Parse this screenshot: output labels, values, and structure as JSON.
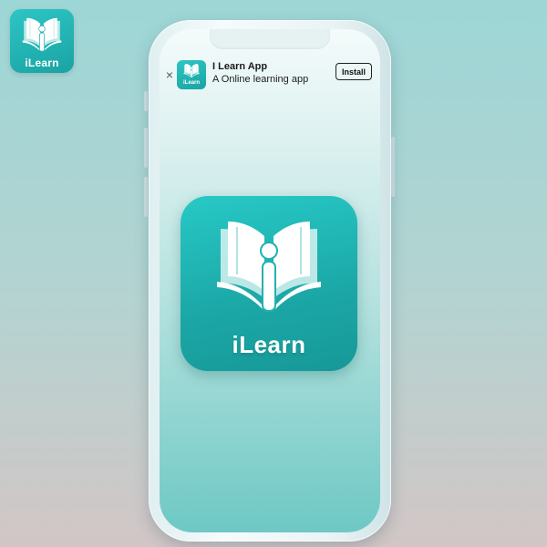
{
  "brand": {
    "name": "iLearn",
    "logo_icon": "open-book-person-icon",
    "primary_color": "#1fb3b1",
    "accent_color": "#2cc6c4"
  },
  "app_banner": {
    "close_label": "×",
    "app_name": "I Learn App",
    "tagline": "A Online learning app",
    "install_label": "Install"
  },
  "background": {
    "top_color": "#9dd6d6",
    "bottom_color": "#d2c6c6"
  }
}
